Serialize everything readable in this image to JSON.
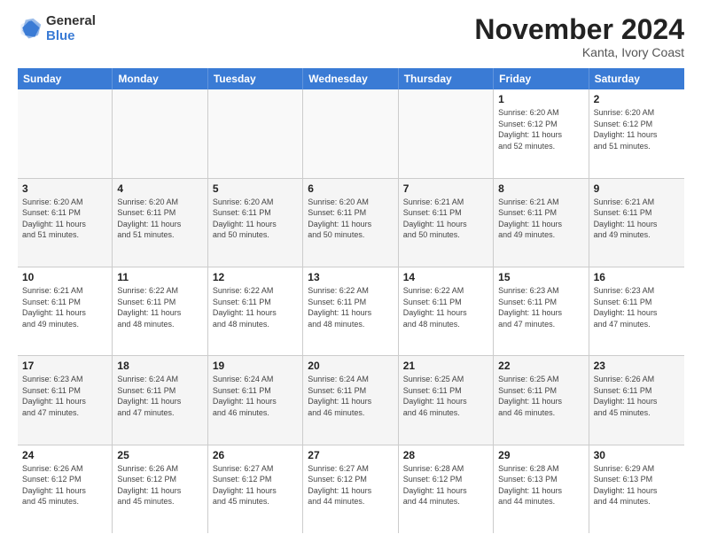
{
  "logo": {
    "general": "General",
    "blue": "Blue"
  },
  "header": {
    "month": "November 2024",
    "location": "Kanta, Ivory Coast"
  },
  "weekdays": [
    "Sunday",
    "Monday",
    "Tuesday",
    "Wednesday",
    "Thursday",
    "Friday",
    "Saturday"
  ],
  "rows": [
    [
      {
        "day": "",
        "info": "",
        "empty": true
      },
      {
        "day": "",
        "info": "",
        "empty": true
      },
      {
        "day": "",
        "info": "",
        "empty": true
      },
      {
        "day": "",
        "info": "",
        "empty": true
      },
      {
        "day": "",
        "info": "",
        "empty": true
      },
      {
        "day": "1",
        "info": "Sunrise: 6:20 AM\nSunset: 6:12 PM\nDaylight: 11 hours\nand 52 minutes.",
        "empty": false
      },
      {
        "day": "2",
        "info": "Sunrise: 6:20 AM\nSunset: 6:12 PM\nDaylight: 11 hours\nand 51 minutes.",
        "empty": false
      }
    ],
    [
      {
        "day": "3",
        "info": "Sunrise: 6:20 AM\nSunset: 6:11 PM\nDaylight: 11 hours\nand 51 minutes.",
        "empty": false
      },
      {
        "day": "4",
        "info": "Sunrise: 6:20 AM\nSunset: 6:11 PM\nDaylight: 11 hours\nand 51 minutes.",
        "empty": false
      },
      {
        "day": "5",
        "info": "Sunrise: 6:20 AM\nSunset: 6:11 PM\nDaylight: 11 hours\nand 50 minutes.",
        "empty": false
      },
      {
        "day": "6",
        "info": "Sunrise: 6:20 AM\nSunset: 6:11 PM\nDaylight: 11 hours\nand 50 minutes.",
        "empty": false
      },
      {
        "day": "7",
        "info": "Sunrise: 6:21 AM\nSunset: 6:11 PM\nDaylight: 11 hours\nand 50 minutes.",
        "empty": false
      },
      {
        "day": "8",
        "info": "Sunrise: 6:21 AM\nSunset: 6:11 PM\nDaylight: 11 hours\nand 49 minutes.",
        "empty": false
      },
      {
        "day": "9",
        "info": "Sunrise: 6:21 AM\nSunset: 6:11 PM\nDaylight: 11 hours\nand 49 minutes.",
        "empty": false
      }
    ],
    [
      {
        "day": "10",
        "info": "Sunrise: 6:21 AM\nSunset: 6:11 PM\nDaylight: 11 hours\nand 49 minutes.",
        "empty": false
      },
      {
        "day": "11",
        "info": "Sunrise: 6:22 AM\nSunset: 6:11 PM\nDaylight: 11 hours\nand 48 minutes.",
        "empty": false
      },
      {
        "day": "12",
        "info": "Sunrise: 6:22 AM\nSunset: 6:11 PM\nDaylight: 11 hours\nand 48 minutes.",
        "empty": false
      },
      {
        "day": "13",
        "info": "Sunrise: 6:22 AM\nSunset: 6:11 PM\nDaylight: 11 hours\nand 48 minutes.",
        "empty": false
      },
      {
        "day": "14",
        "info": "Sunrise: 6:22 AM\nSunset: 6:11 PM\nDaylight: 11 hours\nand 48 minutes.",
        "empty": false
      },
      {
        "day": "15",
        "info": "Sunrise: 6:23 AM\nSunset: 6:11 PM\nDaylight: 11 hours\nand 47 minutes.",
        "empty": false
      },
      {
        "day": "16",
        "info": "Sunrise: 6:23 AM\nSunset: 6:11 PM\nDaylight: 11 hours\nand 47 minutes.",
        "empty": false
      }
    ],
    [
      {
        "day": "17",
        "info": "Sunrise: 6:23 AM\nSunset: 6:11 PM\nDaylight: 11 hours\nand 47 minutes.",
        "empty": false
      },
      {
        "day": "18",
        "info": "Sunrise: 6:24 AM\nSunset: 6:11 PM\nDaylight: 11 hours\nand 47 minutes.",
        "empty": false
      },
      {
        "day": "19",
        "info": "Sunrise: 6:24 AM\nSunset: 6:11 PM\nDaylight: 11 hours\nand 46 minutes.",
        "empty": false
      },
      {
        "day": "20",
        "info": "Sunrise: 6:24 AM\nSunset: 6:11 PM\nDaylight: 11 hours\nand 46 minutes.",
        "empty": false
      },
      {
        "day": "21",
        "info": "Sunrise: 6:25 AM\nSunset: 6:11 PM\nDaylight: 11 hours\nand 46 minutes.",
        "empty": false
      },
      {
        "day": "22",
        "info": "Sunrise: 6:25 AM\nSunset: 6:11 PM\nDaylight: 11 hours\nand 46 minutes.",
        "empty": false
      },
      {
        "day": "23",
        "info": "Sunrise: 6:26 AM\nSunset: 6:11 PM\nDaylight: 11 hours\nand 45 minutes.",
        "empty": false
      }
    ],
    [
      {
        "day": "24",
        "info": "Sunrise: 6:26 AM\nSunset: 6:12 PM\nDaylight: 11 hours\nand 45 minutes.",
        "empty": false
      },
      {
        "day": "25",
        "info": "Sunrise: 6:26 AM\nSunset: 6:12 PM\nDaylight: 11 hours\nand 45 minutes.",
        "empty": false
      },
      {
        "day": "26",
        "info": "Sunrise: 6:27 AM\nSunset: 6:12 PM\nDaylight: 11 hours\nand 45 minutes.",
        "empty": false
      },
      {
        "day": "27",
        "info": "Sunrise: 6:27 AM\nSunset: 6:12 PM\nDaylight: 11 hours\nand 44 minutes.",
        "empty": false
      },
      {
        "day": "28",
        "info": "Sunrise: 6:28 AM\nSunset: 6:12 PM\nDaylight: 11 hours\nand 44 minutes.",
        "empty": false
      },
      {
        "day": "29",
        "info": "Sunrise: 6:28 AM\nSunset: 6:13 PM\nDaylight: 11 hours\nand 44 minutes.",
        "empty": false
      },
      {
        "day": "30",
        "info": "Sunrise: 6:29 AM\nSunset: 6:13 PM\nDaylight: 11 hours\nand 44 minutes.",
        "empty": false
      }
    ]
  ]
}
